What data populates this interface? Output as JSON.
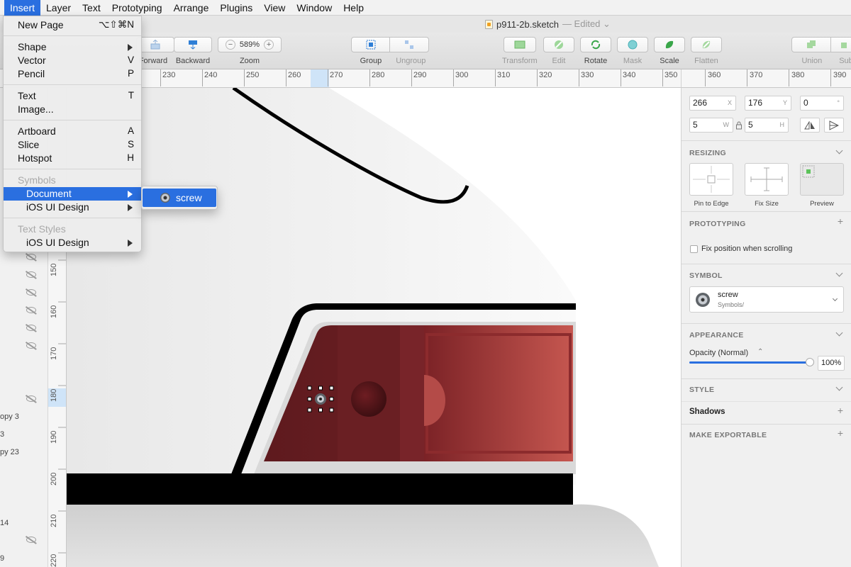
{
  "menubar": {
    "items": [
      "Insert",
      "Layer",
      "Text",
      "Prototyping",
      "Arrange",
      "Plugins",
      "View",
      "Window",
      "Help"
    ],
    "active_index": 0
  },
  "window": {
    "title": "p911-2b.sketch",
    "edited_label": "— Edited ⌄"
  },
  "insert_menu": {
    "new_page": {
      "label": "New Page",
      "shortcut": "⌥⇧⌘N"
    },
    "shape": {
      "label": "Shape"
    },
    "vector": {
      "label": "Vector",
      "shortcut": "V"
    },
    "pencil": {
      "label": "Pencil",
      "shortcut": "P"
    },
    "text": {
      "label": "Text",
      "shortcut": "T"
    },
    "image": {
      "label": "Image..."
    },
    "artboard": {
      "label": "Artboard",
      "shortcut": "A"
    },
    "slice": {
      "label": "Slice",
      "shortcut": "S"
    },
    "hotspot": {
      "label": "Hotspot",
      "shortcut": "H"
    },
    "symbols_header": "Symbols",
    "document": {
      "label": "Document"
    },
    "ios_ui_design": {
      "label": "iOS UI Design"
    },
    "text_styles_header": "Text Styles",
    "ios_ui_design_2": {
      "label": "iOS UI Design"
    }
  },
  "document_submenu": {
    "items": [
      {
        "label": "screw",
        "icon": "screw-symbol-icon"
      }
    ]
  },
  "toolbar": {
    "forward": "Forward",
    "backward": "Backward",
    "zoom_label": "Zoom",
    "zoom_value": "589%",
    "zoom_minus": "−",
    "zoom_plus": "+",
    "group": "Group",
    "ungroup": "Ungroup",
    "transform": "Transform",
    "edit": "Edit",
    "rotate": "Rotate",
    "mask": "Mask",
    "scale": "Scale",
    "flatten": "Flatten",
    "union": "Union",
    "subtract": "Subtr"
  },
  "ruler_top": {
    "ticks": [
      "230",
      "240",
      "250",
      "260",
      "270",
      "280",
      "290",
      "300",
      "310",
      "320",
      "330",
      "340",
      "350",
      "360",
      "370",
      "380",
      "390"
    ]
  },
  "ruler_left": {
    "ticks": [
      "150",
      "160",
      "170",
      "180",
      "190",
      "200",
      "210",
      "220"
    ]
  },
  "layers": {
    "partial_labels": [
      "opy 3",
      "3",
      "py 23",
      "14",
      "9"
    ]
  },
  "inspector": {
    "x": "266",
    "x_suffix": "X",
    "y": "176",
    "y_suffix": "Y",
    "rotation": "0",
    "rotation_suffix": "°",
    "w": "5",
    "w_suffix": "W",
    "h": "5",
    "h_suffix": "H",
    "resizing": {
      "title": "RESIZING",
      "options": [
        "Pin to Edge",
        "Fix Size",
        "Preview"
      ]
    },
    "prototyping": {
      "title": "PROTOTYPING",
      "fix_position_label": "Fix position when scrolling",
      "fix_position_checked": false
    },
    "symbol": {
      "title": "SYMBOL",
      "name": "screw",
      "path": "Symbols/"
    },
    "appearance": {
      "title": "APPEARANCE",
      "opacity_label": "Opacity (Normal)",
      "opacity_value": "100%",
      "opacity_level": 1.0
    },
    "style": {
      "title": "STYLE"
    },
    "shadows": {
      "title": "Shadows"
    },
    "export": {
      "title": "MAKE EXPORTABLE"
    }
  },
  "colors": {
    "accent": "#2a6fe0",
    "taillight_dark": "#5e1a1e",
    "taillight_light": "#b8433f"
  }
}
